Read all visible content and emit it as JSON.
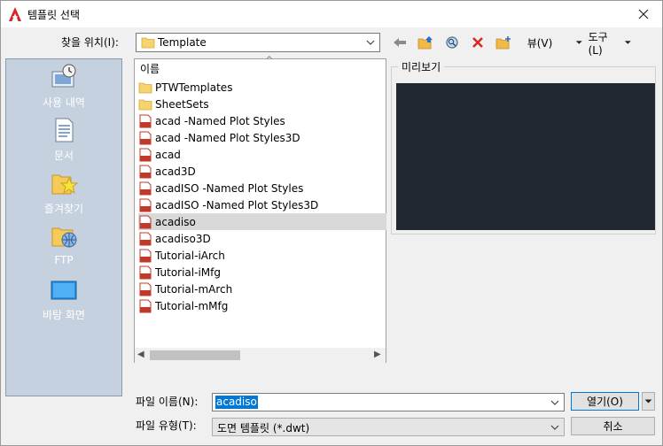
{
  "window": {
    "title": "템플릿 선택"
  },
  "lookin": {
    "label": "찾을 위치(I):",
    "value": "Template"
  },
  "toolbar": {
    "views_label": "뷰(V)",
    "tools_label": "도구(L)"
  },
  "places": [
    {
      "label": "사용 내역",
      "icon": "history-icon"
    },
    {
      "label": "문서",
      "icon": "documents-icon"
    },
    {
      "label": "즐겨찾기",
      "icon": "favorites-icon"
    },
    {
      "label": "FTP",
      "icon": "ftp-icon"
    },
    {
      "label": "바탕 화면",
      "icon": "desktop-icon"
    }
  ],
  "filelist": {
    "header": "이름",
    "items": [
      {
        "name": "PTWTemplates",
        "type": "folder"
      },
      {
        "name": "SheetSets",
        "type": "folder"
      },
      {
        "name": "acad -Named Plot Styles",
        "type": "dwt"
      },
      {
        "name": "acad -Named Plot Styles3D",
        "type": "dwt"
      },
      {
        "name": "acad",
        "type": "dwt"
      },
      {
        "name": "acad3D",
        "type": "dwt"
      },
      {
        "name": "acadISO -Named Plot Styles",
        "type": "dwt"
      },
      {
        "name": "acadISO -Named Plot Styles3D",
        "type": "dwt"
      },
      {
        "name": "acadiso",
        "type": "dwt",
        "selected": true
      },
      {
        "name": "acadiso3D",
        "type": "dwt"
      },
      {
        "name": "Tutorial-iArch",
        "type": "dwt"
      },
      {
        "name": "Tutorial-iMfg",
        "type": "dwt"
      },
      {
        "name": "Tutorial-mArch",
        "type": "dwt"
      },
      {
        "name": "Tutorial-mMfg",
        "type": "dwt"
      }
    ]
  },
  "preview": {
    "label": "미리보기"
  },
  "filename": {
    "label": "파일 이름(N):",
    "value": "acadiso"
  },
  "filetype": {
    "label": "파일 유형(T):",
    "value": "도면 템플릿 (*.dwt)"
  },
  "buttons": {
    "open_label": "열기(O)",
    "cancel_label": "취소"
  },
  "colors": {
    "selection": "#0078d7",
    "preview_bg": "#212830",
    "places_bg": "#c5d1df"
  }
}
